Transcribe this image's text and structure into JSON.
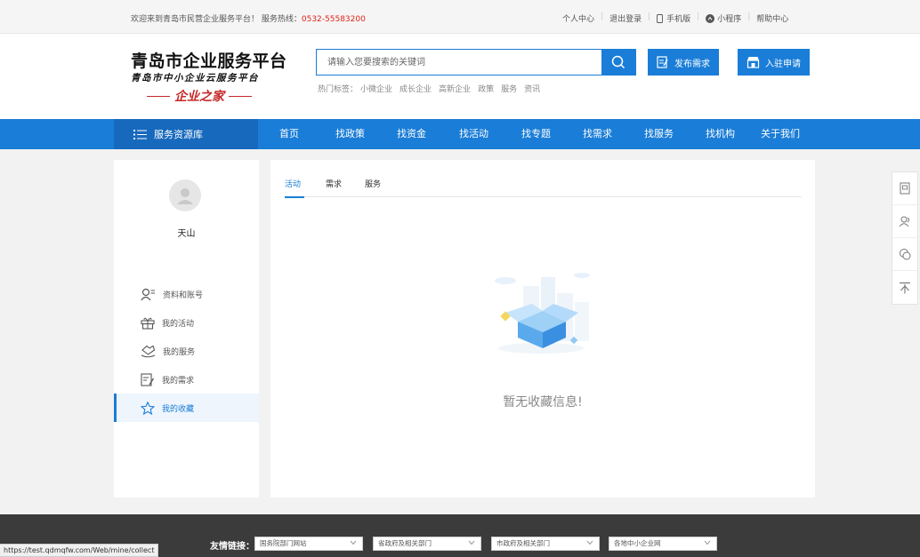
{
  "topbar": {
    "welcome": "欢迎来到青岛市民营企业服务平台！ 服务热线：",
    "hotline": "0532-55583200",
    "links": [
      "个人中心",
      "退出登录",
      "手机版",
      "小程序",
      "帮助中心"
    ]
  },
  "logo": {
    "line1": "青岛市企业服务平台",
    "line2": "青岛市中小企业云服务平台",
    "line3": "企业之家"
  },
  "search": {
    "placeholder": "请输入您要搜索的关键词",
    "hot_label": "热门标签：",
    "hot_tags": [
      "小微企业",
      "成长企业",
      "高新企业",
      "政策",
      "服务",
      "资讯"
    ]
  },
  "header_buttons": {
    "publish": "发布需求",
    "apply": "入驻申请"
  },
  "nav": {
    "resource": "服务资源库",
    "items": [
      "首页",
      "找政策",
      "找资金",
      "找活动",
      "找专题",
      "找需求",
      "找服务",
      "找机构",
      "关于我们"
    ]
  },
  "sidebar": {
    "username": "天山",
    "menu": [
      "资料和账号",
      "我的活动",
      "我的服务",
      "我的需求",
      "我的收藏"
    ],
    "active_index": 4
  },
  "content": {
    "tabs": [
      "活动",
      "需求",
      "服务"
    ],
    "active_tab": 0,
    "empty_text": "暂无收藏信息!"
  },
  "footer": {
    "label": "友情链接：",
    "selects": [
      "国务院部门网站",
      "省政府及相关部门",
      "市政府及相关部门",
      "各地中小企业网"
    ]
  },
  "statusbar": {
    "url": "https://test.qdmqfw.com/Web/mine/collect"
  },
  "colors": {
    "primary": "#1a7dd7",
    "hotline": "#e2231a",
    "slogan": "#c62828",
    "footer": "#3b3b3b"
  }
}
